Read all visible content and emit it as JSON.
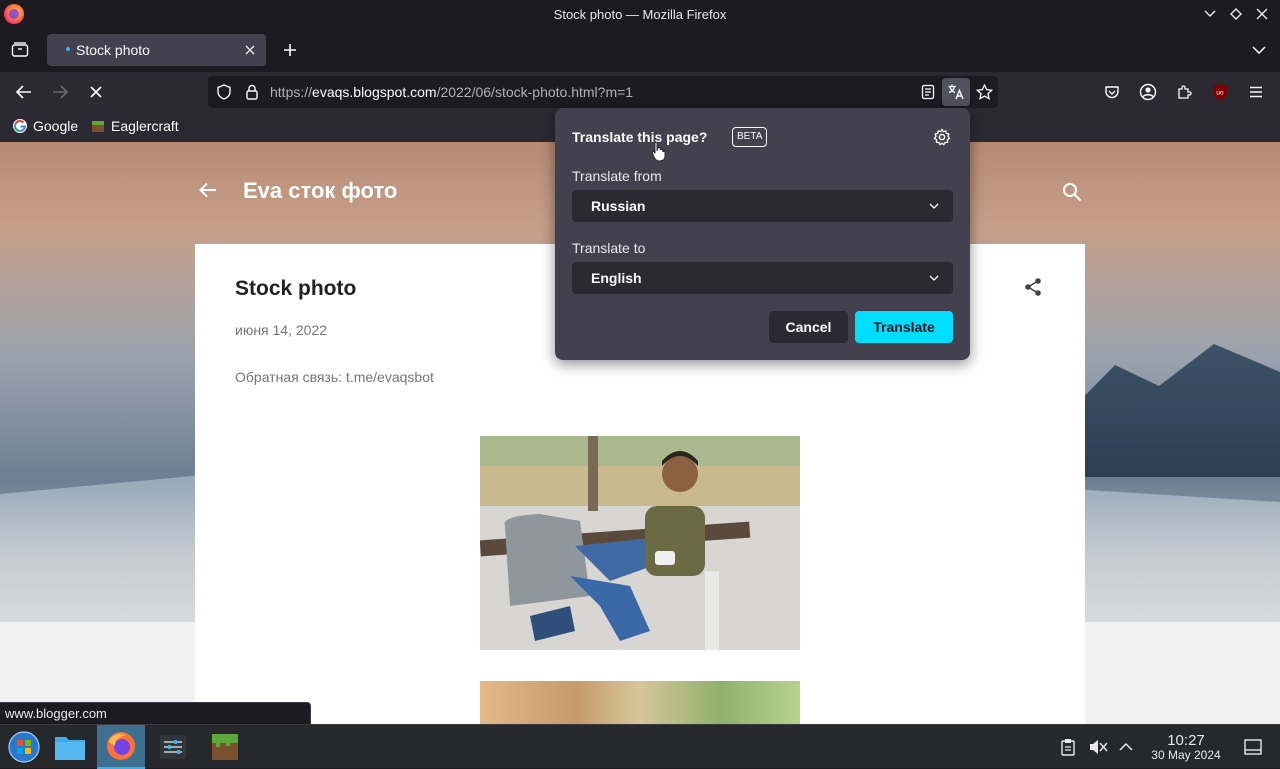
{
  "window": {
    "title": "Stock photo — Mozilla Firefox"
  },
  "tabs": [
    {
      "label": "Stock photo",
      "active": true
    }
  ],
  "urlbar": {
    "scheme": "https://",
    "host": "evaqs.blogspot.com",
    "path": "/2022/06/stock-photo.html?m=1"
  },
  "bookmarks": [
    {
      "label": "Google"
    },
    {
      "label": "Eaglercraft"
    }
  ],
  "blog": {
    "title": "Eva сток фото",
    "post": {
      "title": "Stock photo",
      "date": "июня 14, 2022",
      "body": "Обратная связь: t.me/evaqsbot"
    }
  },
  "status_link": "www.blogger.com",
  "translate_panel": {
    "title": "Translate this page?",
    "badge": "BETA",
    "from_label": "Translate from",
    "from_value": "Russian",
    "to_label": "Translate to",
    "to_value": "English",
    "cancel_label": "Cancel",
    "translate_label": "Translate"
  },
  "taskbar": {
    "time": "10:27",
    "date": "30 May 2024"
  },
  "colors": {
    "browser_bg": "#1c1b22",
    "toolbar_bg": "#2b2a33",
    "panel_bg": "#42414d",
    "accent_translate": "#00ddff",
    "taskbar_bg": "#26282b"
  }
}
